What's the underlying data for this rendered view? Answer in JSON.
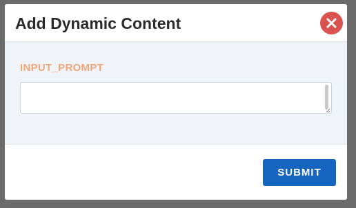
{
  "dialog": {
    "title": "Add Dynamic Content",
    "close_icon": "close-x-icon"
  },
  "form": {
    "input_label": "INPUT_PROMPT",
    "input_value": "",
    "input_placeholder": ""
  },
  "footer": {
    "submit_label": "SUBMIT"
  },
  "colors": {
    "close_button": "#d9534f",
    "submit_button": "#1565c0",
    "label_accent": "#eea577",
    "body_background": "#f0f4f9"
  }
}
